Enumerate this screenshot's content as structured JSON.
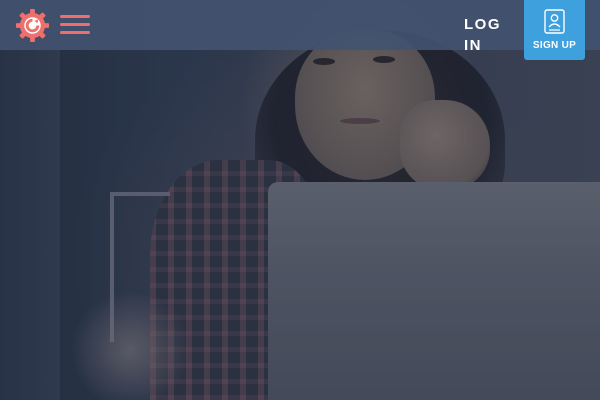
{
  "header": {
    "logo_icon": "gear-refresh-logo-icon",
    "menu_icon": "hamburger-menu-icon",
    "login_label": "LOG IN",
    "signup_label": "SIGN UP",
    "signup_icon": "id-badge-user-icon"
  },
  "colors": {
    "accent": "#ef6f6c",
    "signup_bg": "#3ea0dc",
    "header_bg": "#425270"
  }
}
